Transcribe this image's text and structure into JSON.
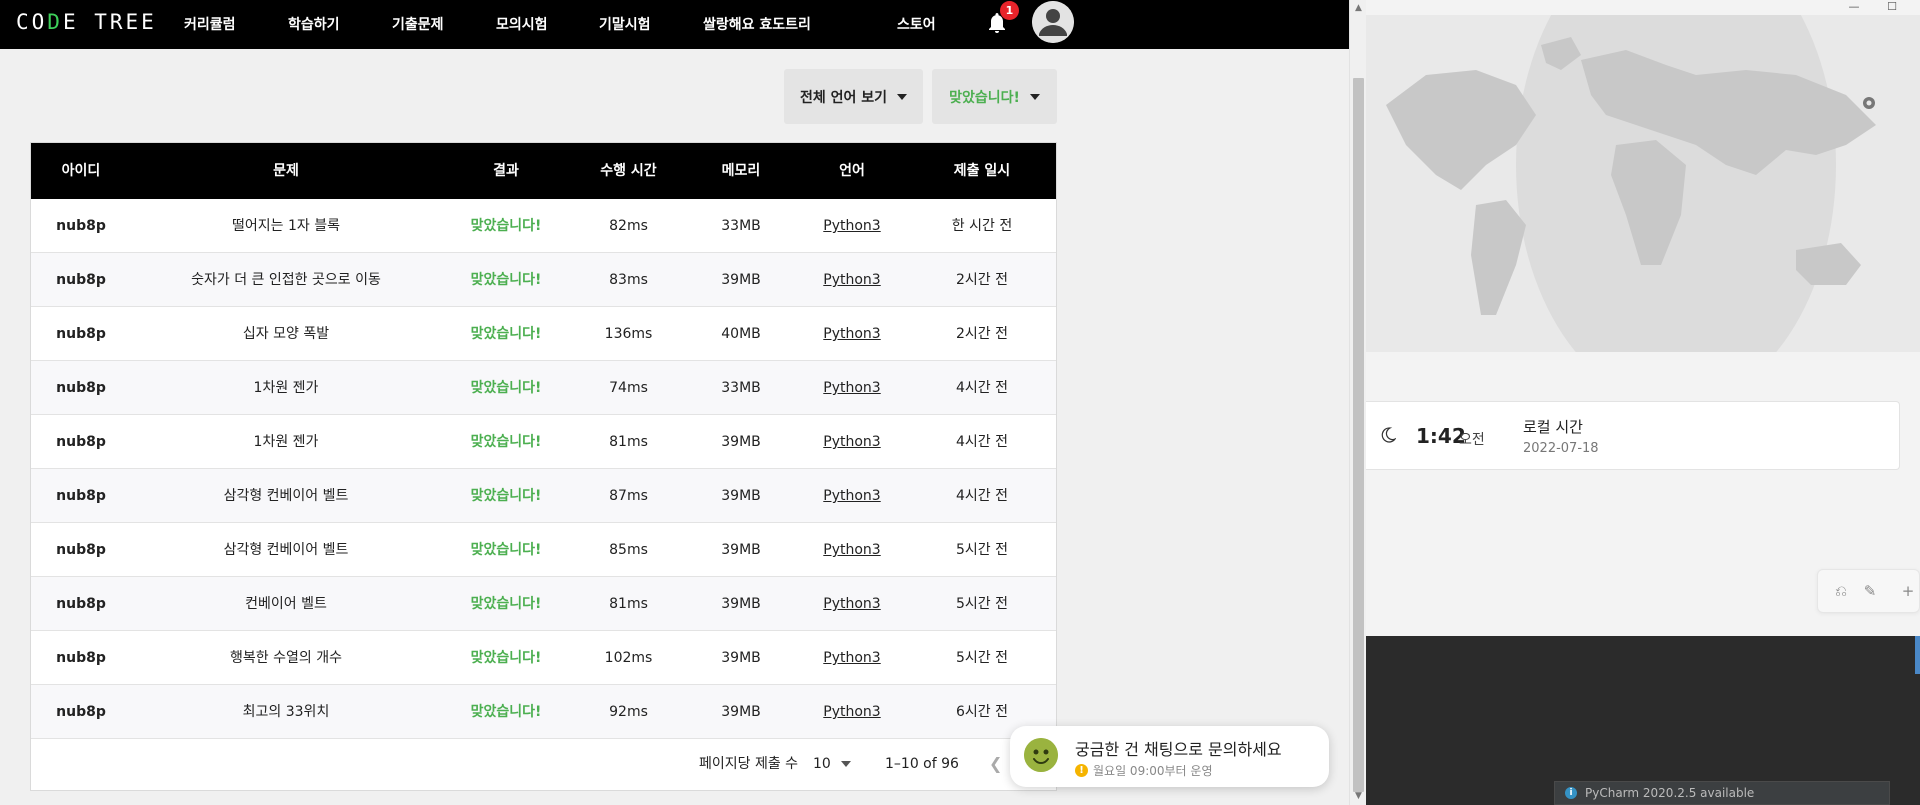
{
  "navbar": {
    "logo": {
      "part1": "CO",
      "part2": "D",
      "part3": "E TREE"
    },
    "items": [
      "커리큘럼",
      "학습하기",
      "기출문제",
      "모의시험",
      "기말시험",
      "쌀랑해요 효도트리",
      "스토어"
    ],
    "notification_count": "1"
  },
  "filters": {
    "language": "전체 언어 보기",
    "result": "맞았습니다!"
  },
  "table": {
    "headers": [
      "아이디",
      "문제",
      "결과",
      "수행 시간",
      "메모리",
      "언어",
      "제출 일시"
    ],
    "rows": [
      {
        "id": "nub8p",
        "problem": "떨어지는 1자 블록",
        "result": "맞았습니다!",
        "time": "82ms",
        "memory": "33MB",
        "lang": "Python3",
        "submitted": "한 시간 전"
      },
      {
        "id": "nub8p",
        "problem": "숫자가 더 큰 인접한 곳으로 이동",
        "result": "맞았습니다!",
        "time": "83ms",
        "memory": "39MB",
        "lang": "Python3",
        "submitted": "2시간 전"
      },
      {
        "id": "nub8p",
        "problem": "십자 모양 폭발",
        "result": "맞았습니다!",
        "time": "136ms",
        "memory": "40MB",
        "lang": "Python3",
        "submitted": "2시간 전"
      },
      {
        "id": "nub8p",
        "problem": "1차원 젠가",
        "result": "맞았습니다!",
        "time": "74ms",
        "memory": "33MB",
        "lang": "Python3",
        "submitted": "4시간 전"
      },
      {
        "id": "nub8p",
        "problem": "1차원 젠가",
        "result": "맞았습니다!",
        "time": "81ms",
        "memory": "39MB",
        "lang": "Python3",
        "submitted": "4시간 전"
      },
      {
        "id": "nub8p",
        "problem": "삼각형 컨베이어 벨트",
        "result": "맞았습니다!",
        "time": "87ms",
        "memory": "39MB",
        "lang": "Python3",
        "submitted": "4시간 전"
      },
      {
        "id": "nub8p",
        "problem": "삼각형 컨베이어 벨트",
        "result": "맞았습니다!",
        "time": "85ms",
        "memory": "39MB",
        "lang": "Python3",
        "submitted": "5시간 전"
      },
      {
        "id": "nub8p",
        "problem": "컨베이어 벨트",
        "result": "맞았습니다!",
        "time": "81ms",
        "memory": "39MB",
        "lang": "Python3",
        "submitted": "5시간 전"
      },
      {
        "id": "nub8p",
        "problem": "행복한 수열의 개수",
        "result": "맞았습니다!",
        "time": "102ms",
        "memory": "39MB",
        "lang": "Python3",
        "submitted": "5시간 전"
      },
      {
        "id": "nub8p",
        "problem": "최고의 33위치",
        "result": "맞았습니다!",
        "time": "92ms",
        "memory": "39MB",
        "lang": "Python3",
        "submitted": "6시간 전"
      }
    ]
  },
  "pagination": {
    "per_page_label": "페이지당 제출 수",
    "per_page": "10",
    "range": "1–10 of 96",
    "prev_icon": "chevron-left-icon"
  },
  "chat": {
    "title": "궁금한 건 채팅으로 문의하세요",
    "subtitle": "월요일 09:00부터 운영",
    "warn_icon": "!"
  },
  "clock": {
    "time": "1:42",
    "ampm": "오전",
    "label": "로컬 시간",
    "date": "2022-07-18"
  },
  "ide": {
    "notification": "PyCharm 2020.2.5 available",
    "info_icon": "i"
  },
  "colors": {
    "accent_green": "#4caf50",
    "logo_green": "#3ecf5a",
    "badge_red": "#e8232a",
    "navbar": "#000000"
  }
}
